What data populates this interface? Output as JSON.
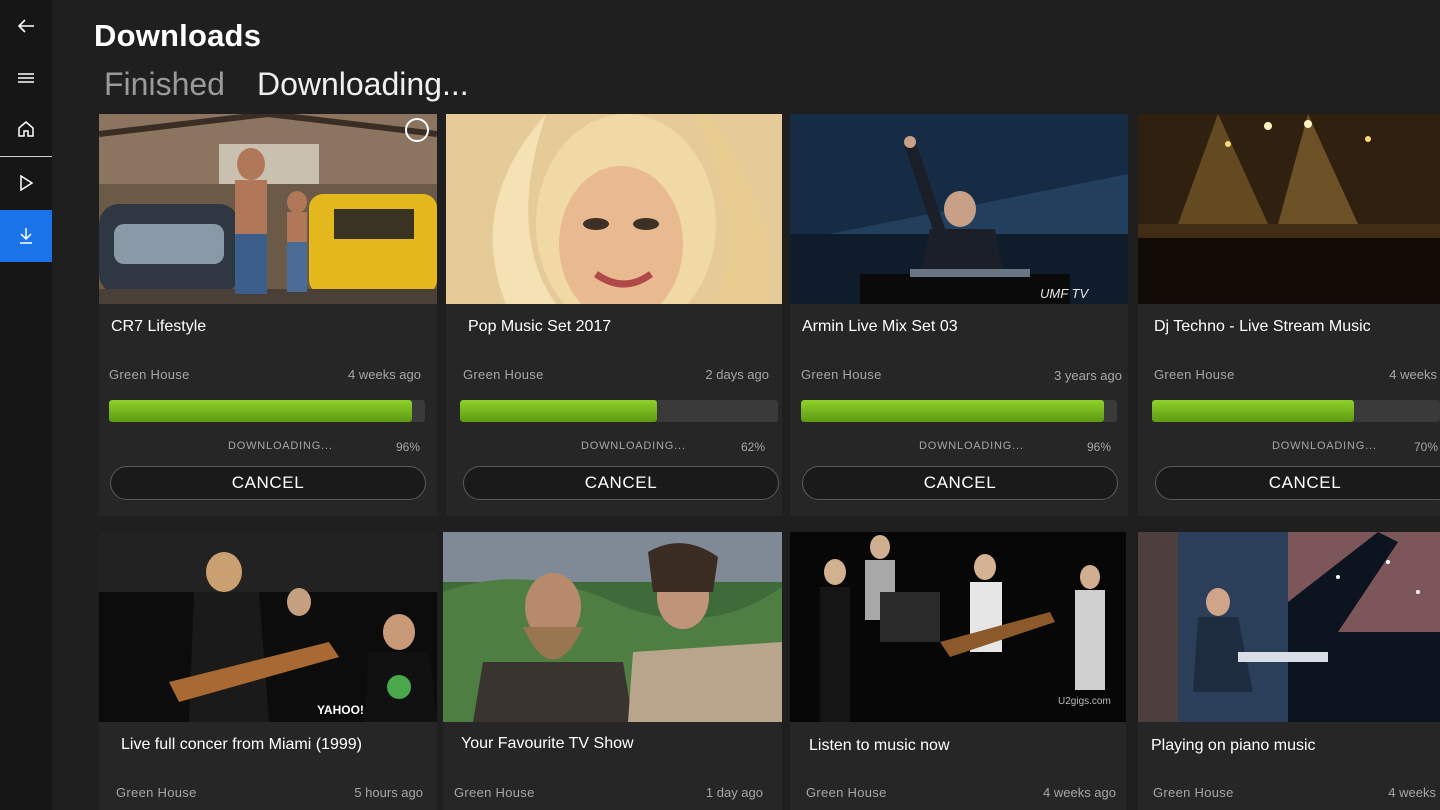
{
  "page": {
    "title": "Downloads"
  },
  "tabs": [
    {
      "label": "Finished"
    },
    {
      "label": "Downloading..."
    }
  ],
  "nav": {
    "items": [
      "back-arrow-icon",
      "hamburger-menu-icon",
      "home-icon",
      "play-icon",
      "download-icon"
    ],
    "accent": "#1a73e8"
  },
  "downloads": [
    {
      "title": "CR7 Lifestyle",
      "channel": "Green House",
      "age": "4 weeks ago",
      "status": "DOWNLOADING...",
      "percent": "96%",
      "progress": 0.96,
      "cancel": "CANCEL"
    },
    {
      "title": "Pop Music Set 2017",
      "channel": "Green House",
      "age": "2 days ago",
      "status": "DOWNLOADING...",
      "percent": "62%",
      "progress": 0.62,
      "cancel": "CANCEL"
    },
    {
      "title": "Armin Live Mix Set 03",
      "channel": "Green House",
      "age": "3 years ago",
      "status": "DOWNLOADING...",
      "percent": "96%",
      "progress": 0.96,
      "cancel": "CANCEL"
    },
    {
      "title": "Dj Techno - Live Stream Music",
      "channel": "Green House",
      "age": "4 weeks",
      "status": "DOWNLOADING...",
      "percent": "70%",
      "progress": 0.7,
      "cancel": "CANCEL"
    }
  ],
  "videos": [
    {
      "title": "Live full concer from Miami (1999)",
      "channel": "Green House",
      "age": "5 hours ago"
    },
    {
      "title": "Your Favourite TV Show",
      "channel": "Green House",
      "age": "1 day ago"
    },
    {
      "title": "Listen to music now",
      "channel": "Green House",
      "age": "4 weeks ago"
    },
    {
      "title": "Playing on piano music",
      "channel": "Green House",
      "age": "4 weeks"
    }
  ],
  "thumb_text": {
    "umf": "UMF TV",
    "u2": "U2gigs.com",
    "yahoo": "YAHOO!"
  }
}
